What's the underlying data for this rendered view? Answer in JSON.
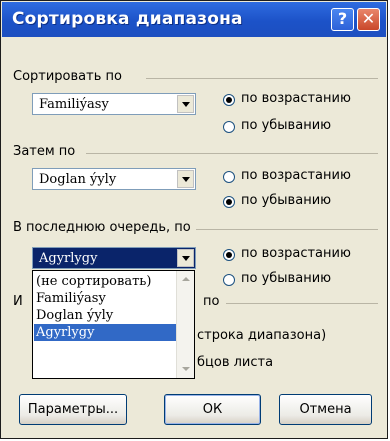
{
  "window": {
    "title": "Сортировка диапазона",
    "help_glyph": "?",
    "close_glyph": "✕"
  },
  "sort_by": {
    "label": "Сортировать по",
    "selected": "Familiýasy",
    "ascending_label": "по возрастанию",
    "descending_label": "по убыванию",
    "choice": "ascending"
  },
  "then_by": {
    "label": "Затем по",
    "selected": "Doglan ýyly",
    "ascending_label": "по возрастанию",
    "descending_label": "по убыванию",
    "choice": "descending"
  },
  "finally_by": {
    "label": "В последнюю очередь, по",
    "selected": "Agyrlygy",
    "ascending_label": "по возрастанию",
    "descending_label": "по убыванию",
    "choice": "ascending"
  },
  "dropdown": {
    "options": [
      "(не сортировать)",
      "Familiýasy",
      "Doglan ýyly",
      "Agyrlygy"
    ],
    "selected_index": 3
  },
  "identify": {
    "label_prefix": "И",
    "label_suffix": "по",
    "option1_visible": "строка диапазона)",
    "option2_visible": "бцов листа"
  },
  "buttons": {
    "params": "Параметры...",
    "ok": "ОК",
    "cancel": "Отмена"
  },
  "colors": {
    "titlebar": "#1c52c8",
    "dialog_bg": "#ece9d8",
    "selection": "#3169c6"
  }
}
